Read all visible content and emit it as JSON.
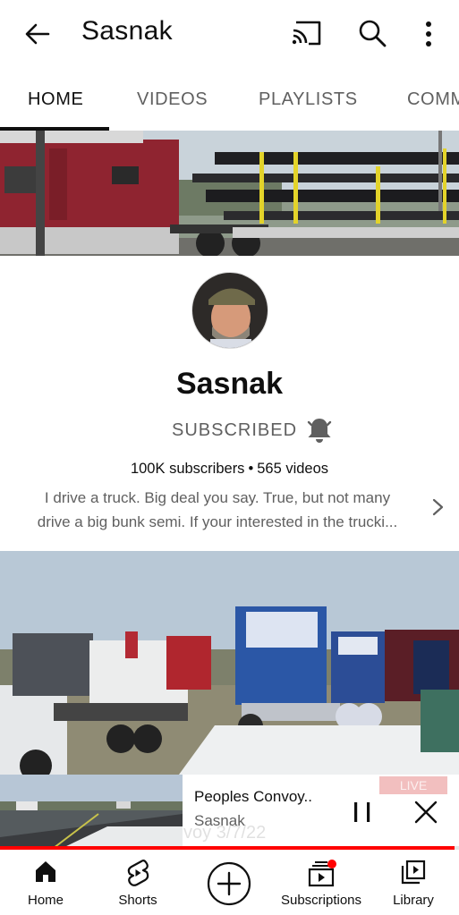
{
  "header": {
    "title": "Sasnak",
    "icons": [
      "back-arrow-icon",
      "cast-icon",
      "search-icon",
      "more-vert-icon"
    ]
  },
  "tabs": [
    {
      "label": "HOME",
      "active": true
    },
    {
      "label": "VIDEOS",
      "active": false
    },
    {
      "label": "PLAYLISTS",
      "active": false
    },
    {
      "label": "COMM",
      "active": false
    }
  ],
  "channel": {
    "name": "Sasnak",
    "subscribe_state": "SUBSCRIBED",
    "subscribers": "100K subscribers",
    "separator": "•",
    "videos": "565 videos",
    "description_line1": "I drive a truck. Big deal you say. True, but not many",
    "description_line2": "drive a big bunk semi. If your interested in the trucki..."
  },
  "miniplayer": {
    "title": "Peoples Convoy..",
    "channel": "Sasnak",
    "underlay_text": "voy 3/7/22",
    "live_badge": "LIVE",
    "progress": 0.99
  },
  "bottom_nav": [
    {
      "label": "Home",
      "icon": "home-icon",
      "active": true
    },
    {
      "label": "Shorts",
      "icon": "shorts-icon"
    },
    {
      "label": "",
      "icon": "create-plus-icon"
    },
    {
      "label": "Subscriptions",
      "icon": "subscriptions-icon",
      "badge": true
    },
    {
      "label": "Library",
      "icon": "library-icon"
    }
  ],
  "colors": {
    "text_primary": "#0f0f0f",
    "text_secondary": "#606060",
    "accent_red": "#ff0000"
  }
}
